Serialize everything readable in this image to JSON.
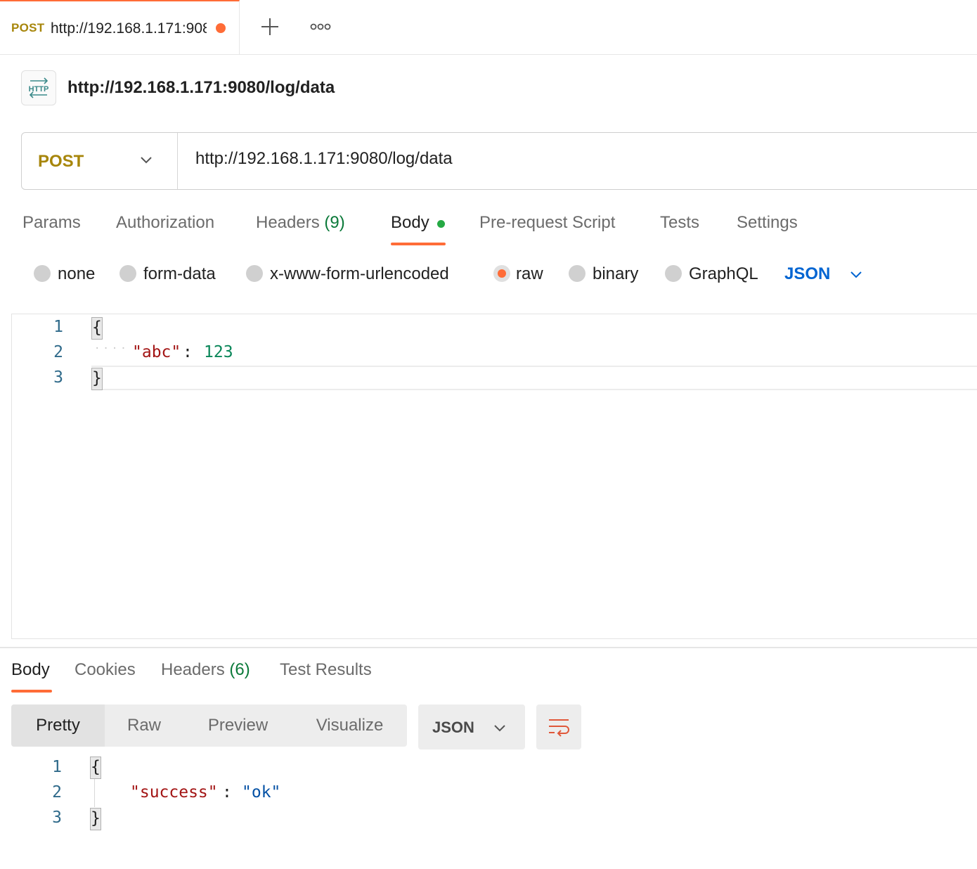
{
  "tab": {
    "method": "POST",
    "url": "http://192.168.1.171:9080/log/data"
  },
  "header": {
    "title": "http://192.168.1.171:9080/log/data",
    "icon": "http-icon"
  },
  "request": {
    "method": "POST",
    "url": "http://192.168.1.171:9080/log/data",
    "tabs": [
      {
        "label": "Params"
      },
      {
        "label": "Authorization"
      },
      {
        "label": "Headers",
        "count": "(9)"
      },
      {
        "label": "Body"
      },
      {
        "label": "Pre-request Script"
      },
      {
        "label": "Tests"
      },
      {
        "label": "Settings"
      }
    ],
    "active_tab": "Body",
    "body_types": [
      "none",
      "form-data",
      "x-www-form-urlencoded",
      "raw",
      "binary",
      "GraphQL"
    ],
    "selected_body_type": "raw",
    "language": "JSON",
    "editor": {
      "line_numbers": [
        "1",
        "2",
        "3"
      ],
      "open_brace": "{",
      "key": "\"abc\"",
      "colon": ":",
      "value": "123",
      "close_brace": "}"
    }
  },
  "response": {
    "tabs": [
      {
        "label": "Body"
      },
      {
        "label": "Cookies"
      },
      {
        "label": "Headers",
        "count": "(6)"
      },
      {
        "label": "Test Results"
      }
    ],
    "active_tab": "Body",
    "views": [
      "Pretty",
      "Raw",
      "Preview",
      "Visualize"
    ],
    "active_view": "Pretty",
    "language": "JSON",
    "body": {
      "line_numbers": [
        "1",
        "2",
        "3"
      ],
      "open_brace": "{",
      "key": "\"success\"",
      "colon": ":",
      "value": "\"ok\"",
      "close_brace": "}"
    }
  },
  "colors": {
    "accent": "#ff6c37",
    "method_post": "#a7860b",
    "link_blue": "#0265d2",
    "success_green": "#25a944"
  }
}
